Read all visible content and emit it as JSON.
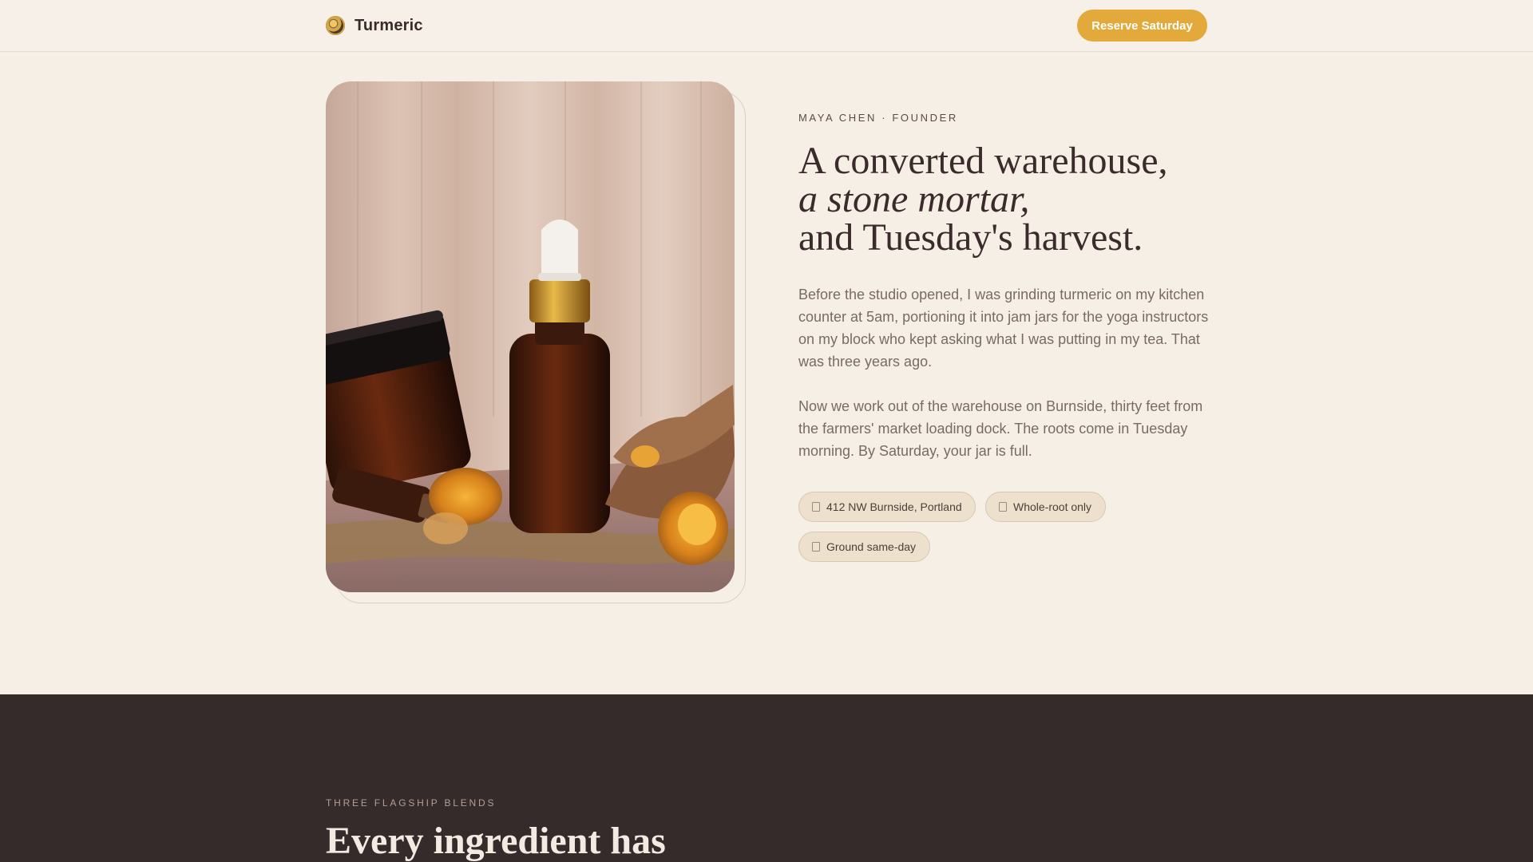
{
  "header": {
    "brand_name": "Turmeric",
    "cta_label": "Reserve Saturday"
  },
  "hero": {
    "eyebrow": "MAYA CHEN · FOUNDER",
    "headline": {
      "line1": "A converted warehouse,",
      "line2": "a stone mortar,",
      "line3": "and Tuesday's harvest."
    },
    "paragraphs": [
      "Before the studio opened, I was grinding turmeric on my kitchen counter at 5am, portioning it into jam jars for the yoga instructors on my block who kept asking what I was putting in my tea. That was three years ago.",
      "Now we work out of the warehouse on Burnside, thirty feet from the farmers' market loading dock. The roots come in Tuesday morning. By Saturday, your jar is full."
    ],
    "chips": [
      {
        "label": "412 NW Burnside, Portland",
        "icon": "location-icon"
      },
      {
        "label": "Whole-root only",
        "icon": "root-icon"
      },
      {
        "label": "Ground same-day",
        "icon": "clock-icon"
      }
    ]
  },
  "flagship": {
    "eyebrow": "THREE FLAGSHIP BLENDS",
    "title": "Every ingredient has"
  },
  "colors": {
    "background": "#f6efe6",
    "accent": "#e3a93a",
    "dark_section": "#362b2b",
    "text": "#3b2b2c"
  }
}
